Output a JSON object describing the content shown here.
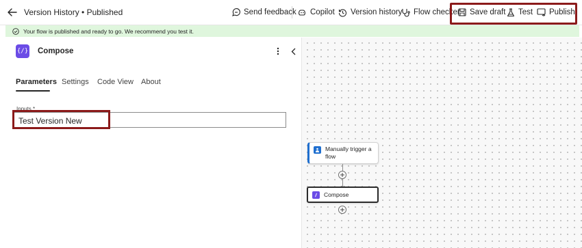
{
  "header": {
    "title": "Version History • Published",
    "send_feedback": "Send feedback",
    "copilot": "Copilot",
    "version_history": "Version history",
    "flow_checker": "Flow checker",
    "save_draft": "Save draft",
    "test": "Test",
    "publish": "Publish"
  },
  "banner": {
    "message": "Your flow is published and ready to go. We recommend you test it."
  },
  "panel": {
    "title": "Compose",
    "tabs": [
      "Parameters",
      "Settings",
      "Code View",
      "About"
    ],
    "active_tab": "Parameters",
    "inputs_label": "Inputs *",
    "inputs_value": "Test Version New"
  },
  "canvas": {
    "trigger_label": "Manually trigger a flow",
    "compose_label": "Compose"
  },
  "colors": {
    "accent_purple": "#6b4ce6",
    "trigger_blue": "#1f6fcf",
    "highlight_red": "#8b1a1a",
    "banner_green": "#dff6dd"
  }
}
